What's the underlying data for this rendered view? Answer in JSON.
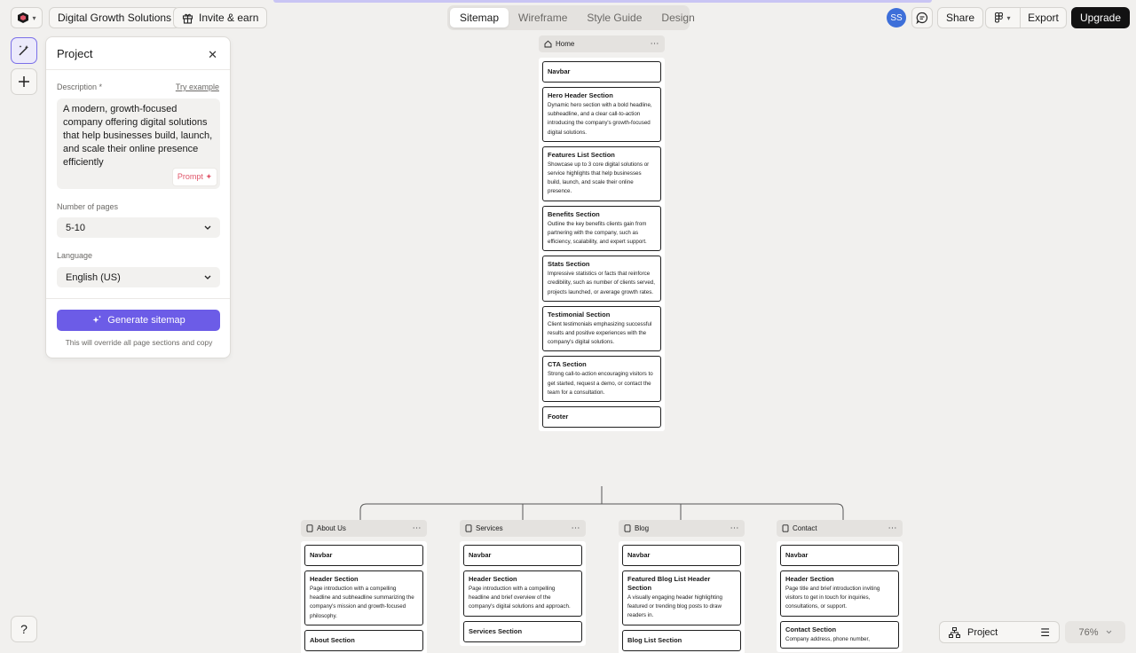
{
  "topbar": {
    "project_name": "Digital Growth Solutions",
    "invite_label": "Invite & earn",
    "tabs": [
      "Sitemap",
      "Wireframe",
      "Style Guide",
      "Design"
    ],
    "active_tab": "Sitemap",
    "avatar_initials": "SS",
    "share_label": "Share",
    "export_label": "Export",
    "upgrade_label": "Upgrade"
  },
  "panel": {
    "title": "Project",
    "description_label": "Description *",
    "try_example": "Try example",
    "description": "A modern, growth-focused company offering digital solutions that help businesses build, launch, and scale their online presence efficiently",
    "prompt_chip": "Prompt",
    "pages_label": "Number of pages",
    "pages_value": "5-10",
    "language_label": "Language",
    "language_value": "English (US)",
    "generate_label": "Generate sitemap",
    "override_note": "This will override all page sections and copy"
  },
  "sitemap": {
    "home": {
      "name": "Home",
      "sections": [
        {
          "title": "Navbar",
          "desc": ""
        },
        {
          "title": "Hero Header Section",
          "desc": "Dynamic hero section with a bold headline, subheadline, and a clear call-to-action introducing the company's growth-focused digital solutions."
        },
        {
          "title": "Features List Section",
          "desc": "Showcase up to 3 core digital solutions or service highlights that help businesses build, launch, and scale their online presence."
        },
        {
          "title": "Benefits Section",
          "desc": "Outline the key benefits clients gain from partnering with the company, such as efficiency, scalability, and expert support."
        },
        {
          "title": "Stats Section",
          "desc": "Impressive statistics or facts that reinforce credibility, such as number of clients served, projects launched, or average growth rates."
        },
        {
          "title": "Testimonial Section",
          "desc": "Client testimonials emphasizing successful results and positive experiences with the company's digital solutions."
        },
        {
          "title": "CTA Section",
          "desc": "Strong call-to-action encouraging visitors to get started, request a demo, or contact the team for a consultation."
        },
        {
          "title": "Footer",
          "desc": ""
        }
      ]
    },
    "children": [
      {
        "name": "About Us",
        "sections": [
          {
            "title": "Navbar",
            "desc": ""
          },
          {
            "title": "Header Section",
            "desc": "Page introduction with a compelling headline and subheadline summarizing the company's mission and growth-focused philosophy."
          },
          {
            "title": "About Section",
            "desc": ""
          }
        ]
      },
      {
        "name": "Services",
        "sections": [
          {
            "title": "Navbar",
            "desc": ""
          },
          {
            "title": "Header Section",
            "desc": "Page introduction with a compelling headline and brief overview of the company's digital solutions and approach."
          },
          {
            "title": "Services Section",
            "desc": ""
          }
        ]
      },
      {
        "name": "Blog",
        "sections": [
          {
            "title": "Navbar",
            "desc": ""
          },
          {
            "title": "Featured Blog List Header Section",
            "desc": "A visually engaging header highlighting featured or trending blog posts to draw readers in."
          },
          {
            "title": "Blog List Section",
            "desc": ""
          }
        ]
      },
      {
        "name": "Contact",
        "sections": [
          {
            "title": "Navbar",
            "desc": ""
          },
          {
            "title": "Header Section",
            "desc": "Page title and brief introduction inviting visitors to get in touch for inquiries, consultations, or support."
          },
          {
            "title": "Contact Section",
            "desc": "Company address, phone number,"
          }
        ]
      }
    ]
  },
  "bottom": {
    "project_label": "Project",
    "zoom": "76%"
  },
  "help_label": "?",
  "colors": {
    "accent": "#6c5ce7",
    "upgrade": "#121212",
    "avatar": "#3d6fd9",
    "prompt": "#e0566a"
  }
}
